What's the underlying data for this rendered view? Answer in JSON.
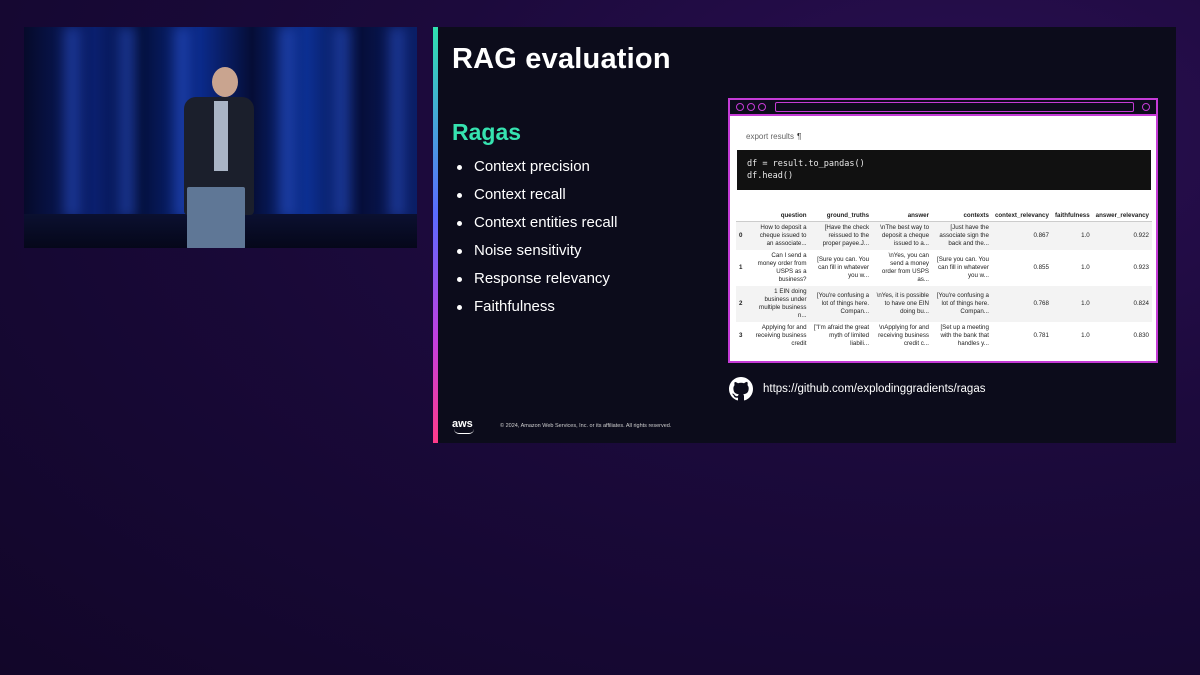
{
  "slide": {
    "title": "RAG evaluation",
    "section_title": "Ragas",
    "bullets": [
      "Context precision",
      "Context recall",
      "Context entities recall",
      "Noise sensitivity",
      "Response relevancy",
      "Faithfulness"
    ],
    "notebook": {
      "export_label": "export results",
      "cursor_glyph": "¶",
      "code_lines": [
        "df = result.to_pandas()",
        "df.head()"
      ],
      "columns": [
        "",
        "question",
        "ground_truths",
        "answer",
        "contexts",
        "context_relevancy",
        "faithfulness",
        "answer_relevancy"
      ],
      "rows": [
        [
          "0",
          "How to deposit a cheque issued to an associate...",
          "[Have the check reissued to the proper payee.J...",
          "\\nThe best way to deposit a cheque issued to a...",
          "[Just have the associate sign the back and the...",
          "0.867",
          "1.0",
          "0.922"
        ],
        [
          "1",
          "Can I send a money order from USPS as a business?",
          "[Sure you can. You can fill in whatever you w...",
          "\\nYes, you can send a money order from USPS as...",
          "[Sure you can. You can fill in whatever you w...",
          "0.855",
          "1.0",
          "0.923"
        ],
        [
          "2",
          "1 EIN doing business under multiple business n...",
          "[You're confusing a lot of things here. Compan...",
          "\\nYes, it is possible to have one EIN doing bu...",
          "[You're confusing a lot of things here. Compan...",
          "0.768",
          "1.0",
          "0.824"
        ],
        [
          "3",
          "Applying for and receiving business credit",
          "[\"I'm afraid the great myth of limited liabili...",
          "\\nApplying for and receiving business credit c...",
          "[Set up a meeting with the bank that handles y...",
          "0.781",
          "1.0",
          "0.830"
        ]
      ]
    },
    "github_url": "https://github.com/explodinggradients/ragas",
    "aws_logo_text": "aws",
    "copyright": "© 2024, Amazon Web Services, Inc. or its affiliates. All rights reserved."
  },
  "colors": {
    "accent_green": "#36e3b0",
    "window_border": "#c53bd6",
    "slide_bg": "#0c0c1b"
  }
}
